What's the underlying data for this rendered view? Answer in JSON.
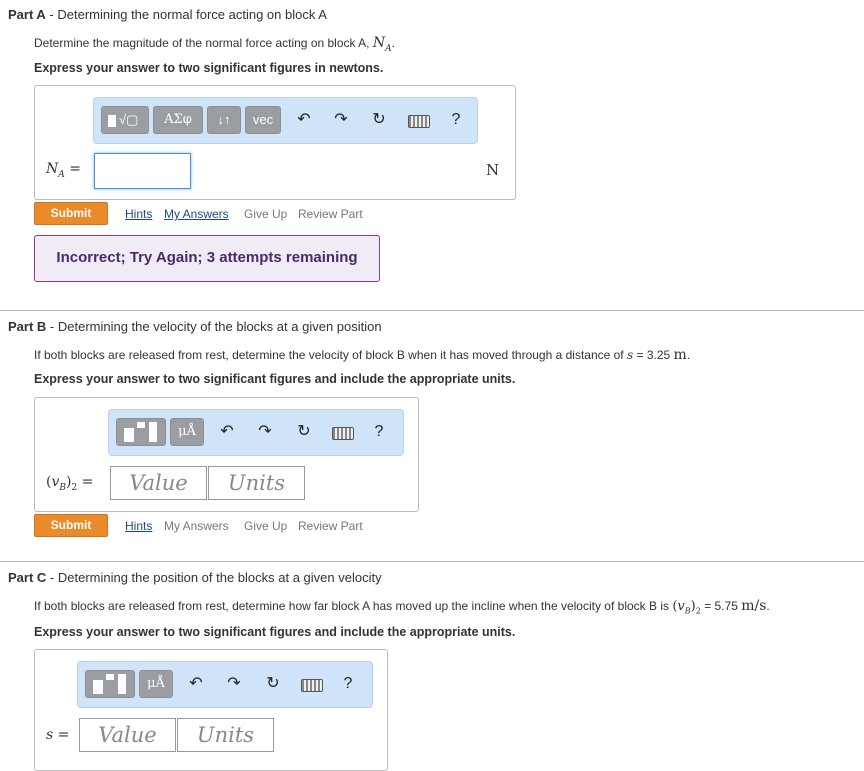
{
  "partA": {
    "title_prefix": "Part A",
    "title_rest": "Determining the normal force acting on block A",
    "question": "Determine the magnitude of the normal force acting on block A,",
    "question_var": "NA",
    "instructions": "Express your answer to two significant figures in newtons.",
    "toolbar": {
      "sym": "ΑΣφ",
      "arrows": "↓↑",
      "vec": "vec",
      "help": "?"
    },
    "answer_label": "NA =",
    "unit": "N",
    "submit": "Submit",
    "links": [
      "Hints",
      "My Answers",
      "Give Up",
      "Review Part"
    ],
    "feedback": "Incorrect; Try Again; 3 attempts remaining"
  },
  "partB": {
    "title_prefix": "Part B",
    "title_rest": "Determining the velocity of the blocks at a given position",
    "question_pre": "If both blocks are released from rest, determine the velocity of block B when it has moved through a distance of",
    "question_var": "s",
    "question_val": "= 3.25",
    "question_unit": "m",
    "instructions": "Express your answer to two significant figures and include the appropriate units.",
    "toolbar": {
      "mu": "μÅ",
      "help": "?"
    },
    "answer_label": "(vB)2 =",
    "value_placeholder": "Value",
    "units_placeholder": "Units",
    "submit": "Submit",
    "links": [
      "Hints",
      "My Answers",
      "Give Up",
      "Review Part"
    ]
  },
  "partC": {
    "title_prefix": "Part C",
    "title_rest": "Determining the position of the blocks at a given velocity",
    "question_pre": "If both blocks are released from rest, determine how far block A has moved up the incline when the velocity of block B is",
    "question_var": "(vB)2",
    "question_val": "= 5.75",
    "question_unit": "m/s",
    "instructions": "Express your answer to two significant figures and include the appropriate units.",
    "toolbar": {
      "mu": "μÅ",
      "help": "?"
    },
    "answer_label": "s =",
    "value_placeholder": "Value",
    "units_placeholder": "Units"
  },
  "colors": {
    "submit": "#e98b2b",
    "toolbar": "#cfe3f9",
    "feedback_border": "#8a3c8d",
    "link": "#1a4a8a"
  }
}
